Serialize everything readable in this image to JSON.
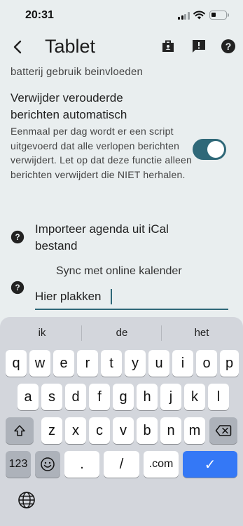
{
  "status": {
    "time": "20:31"
  },
  "appbar": {
    "title": "Tablet",
    "icons": [
      "back-arrow-icon",
      "badge-icon",
      "feedback-icon",
      "help-icon"
    ]
  },
  "content": {
    "cut_off_text": "batterij gebruik beinvloeden",
    "auto_delete_title": "Verwijder verouderde berichten automatisch",
    "auto_delete_desc": "Eenmaal per dag wordt er een script uitgevoerd dat alle verlopen berichten verwijdert. Let op dat deze functie alleen berichten verwijdert die NIET herhalen.",
    "auto_delete_enabled": true,
    "ical_label": "Importeer agenda uit iCal bestand",
    "sync_label": "Sync met online kalender",
    "paste_value": "Hier plakken"
  },
  "keyboard": {
    "suggestions": [
      "ik",
      "de",
      "het"
    ],
    "rows": [
      [
        "q",
        "w",
        "e",
        "r",
        "t",
        "y",
        "u",
        "i",
        "o",
        "p"
      ],
      [
        "a",
        "s",
        "d",
        "f",
        "g",
        "h",
        "j",
        "k",
        "l"
      ],
      [
        "z",
        "x",
        "c",
        "v",
        "b",
        "n",
        "m"
      ]
    ],
    "bottom": {
      "numbers": "123",
      "dot": ".",
      "slash": "/",
      "dotcom": ".com",
      "done": "✓"
    },
    "colors": {
      "accent": "#2f6878",
      "done": "#3478f6"
    }
  }
}
